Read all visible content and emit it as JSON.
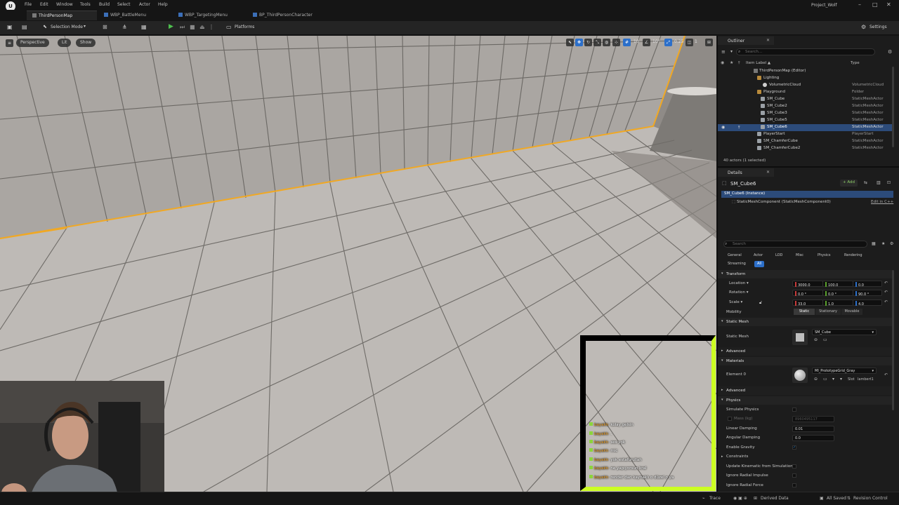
{
  "menu": {
    "items": [
      "File",
      "Edit",
      "Window",
      "Tools",
      "Build",
      "Select",
      "Actor",
      "Help"
    ],
    "project": "Project_Wolf"
  },
  "tabs": [
    "ThirdPersonMap",
    "WBP_BattleMenu",
    "WBP_TargetingMenu",
    "BP_ThirdPersonCharacter"
  ],
  "toolbar": {
    "selection_mode": "Selection Mode",
    "platforms": "Platforms",
    "settings": "Settings"
  },
  "viewport": {
    "perspective": "Perspective",
    "lit": "Lit",
    "show": "Show",
    "grid_snap": "10",
    "rotation_snap": "10°",
    "scale_snap": "0.25",
    "camera_speed": "1"
  },
  "chat": {
    "header": "",
    "messages": [
      {
        "user": "bayaktı",
        "text": "kolay gelsin"
      },
      {
        "user": "bayaktı",
        "text": "."
      },
      {
        "user": "bayaktı",
        "text": "ses yok"
      },
      {
        "user": "bayaktı",
        "text": "mic"
      },
      {
        "user": "bayaktı",
        "text": "yok estafurullah"
      },
      {
        "user": "bayaktı",
        "text": "ne yapıyorsun kral"
      },
      {
        "user": "bayaktı",
        "text": "render dan kaynaklı o düzel o ya"
      }
    ]
  },
  "outliner": {
    "tab": "Outliner",
    "search_placeholder": "Search...",
    "col_label": "Item Label ▲",
    "col_type": "Type",
    "rows": [
      {
        "label": "ThirdPersonMap (Editor)",
        "type": "",
        "icon": "map"
      },
      {
        "label": "Lighting",
        "type": "",
        "icon": "folder"
      },
      {
        "label": "VolumetricCloud",
        "type": "VolumetricCloud",
        "icon": "cloud"
      },
      {
        "label": "Playground",
        "type": "Folder",
        "icon": "folder"
      },
      {
        "label": "SM_Cube",
        "type": "StaticMeshActor",
        "icon": "mesh"
      },
      {
        "label": "SM_Cube2",
        "type": "StaticMeshActor",
        "icon": "mesh"
      },
      {
        "label": "SM_Cube3",
        "type": "StaticMeshActor",
        "icon": "mesh"
      },
      {
        "label": "SM_Cube5",
        "type": "StaticMeshActor",
        "icon": "mesh"
      },
      {
        "label": "SM_Cube6",
        "type": "StaticMeshActor",
        "icon": "mesh"
      },
      {
        "label": "PlayerStart",
        "type": "PlayerStart",
        "icon": "mesh"
      },
      {
        "label": "SM_ChamferCube",
        "type": "StaticMeshActor",
        "icon": "mesh"
      },
      {
        "label": "SM_ChamferCube2",
        "type": "StaticMeshActor",
        "icon": "mesh"
      }
    ],
    "count": "40 actors (1 selected)"
  },
  "details": {
    "tab": "Details",
    "actor_name": "SM_Cube6",
    "add_label": "+ Add",
    "instance": "SM_Cube6 (Instance)",
    "component": "StaticMeshComponent (StaticMeshComponent0)",
    "edit_cpp": "Edit in C++",
    "search_placeholder": "Search",
    "categories": [
      "General",
      "Actor",
      "LOD",
      "Misc",
      "Physics",
      "Rendering",
      "Streaming",
      "All"
    ],
    "transform_header": "Transform",
    "location_label": "Location",
    "rotation_label": "Rotation",
    "scale_label": "Scale",
    "location": [
      "3000.0",
      "100.0",
      "0.0"
    ],
    "rotation": [
      "0.0 °",
      "0.0 °",
      "90.0 °"
    ],
    "scale": [
      "33.0",
      "1.0",
      "4.0"
    ],
    "mobility_label": "Mobility",
    "mobility_options": [
      "Static",
      "Stationary",
      "Movable"
    ],
    "static_mesh_header": "Static Mesh",
    "static_mesh_label": "Static Mesh",
    "static_mesh_value": "SM_Cube",
    "advanced": "Advanced",
    "materials_header": "Materials",
    "element0_label": "Element 0",
    "material_value": "MI_PrototypeGrid_Gray",
    "material_source": "Slot",
    "material_slot": "lambert1",
    "physics_header": "Physics",
    "simulate_physics": "Simulate Physics",
    "mass": "Mass (kg)",
    "mass_value": "8960495117",
    "linear_damping": "Linear Damping",
    "linear_damping_value": "0.01",
    "angular_damping": "Angular Damping",
    "angular_damping_value": "0.0",
    "enable_gravity": "Enable Gravity",
    "constraints": "Constraints",
    "update_kinematic": "Update Kinematic from Simulation",
    "ignore_radial_impulse": "Ignore Radial Impulse",
    "ignore_radial_force": "Ignore Radial Force"
  },
  "statusbar": {
    "trace": "Trace",
    "derived_data": "Derived Data",
    "all_saved": "All Saved",
    "revision_control": "Revision Control"
  },
  "colors": {
    "selection_outline": "#f0a824",
    "accent_blue": "#2c6fc9",
    "chat_border": "#ccff22",
    "play_green": "#4ec04e"
  }
}
